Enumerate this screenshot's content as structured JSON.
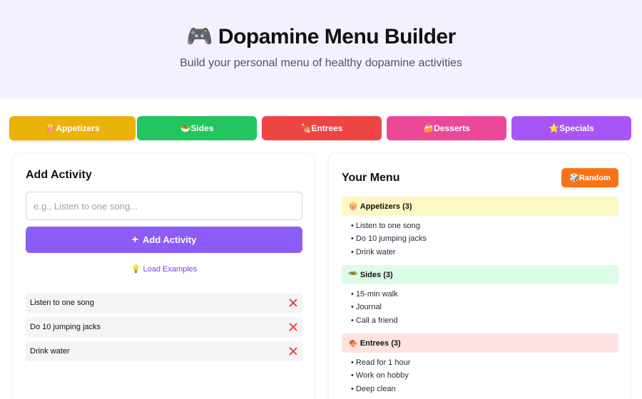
{
  "header": {
    "title_icon": "🎮",
    "title": "Dopamine Menu Builder",
    "subtitle": "Build your personal menu of healthy dopamine activities"
  },
  "tabs": [
    {
      "icon": "🍿",
      "label": "Appetizers",
      "color": "#eab308",
      "active": true
    },
    {
      "icon": "🥗",
      "label": "Sides",
      "color": "#22c55e",
      "active": false
    },
    {
      "icon": "🍖",
      "label": "Entrees",
      "color": "#ef4444",
      "active": false
    },
    {
      "icon": "🍰",
      "label": "Desserts",
      "color": "#ec4899",
      "active": false
    },
    {
      "icon": "⭐",
      "label": "Specials",
      "color": "#a855f7",
      "active": false
    }
  ],
  "add_panel": {
    "title": "Add Activity",
    "input_value": "",
    "input_placeholder": "e.g., Listen to one song...",
    "add_button_icon": "+",
    "add_button_label": "Add Activity",
    "examples_icon": "💡",
    "examples_label": "Load Examples",
    "activities": [
      "Listen to one song",
      "Do 10 jumping jacks",
      "Drink water"
    ]
  },
  "menu_panel": {
    "title": "Your Menu",
    "random_icon": "🎲",
    "random_label": "Random",
    "sections": [
      {
        "icon": "🍿",
        "name": "Appetizers",
        "count_label": "(3)",
        "bg": "#fef9c3",
        "items": [
          "Listen to one song",
          "Do 10 jumping jacks",
          "Drink water"
        ]
      },
      {
        "icon": "🥗",
        "name": "Sides",
        "count_label": "(3)",
        "bg": "#dcfce7",
        "items": [
          "15-min walk",
          "Journal",
          "Call a friend"
        ]
      },
      {
        "icon": "🍖",
        "name": "Entrees",
        "count_label": "(3)",
        "bg": "#fee2e2",
        "items": [
          "Read for 1 hour",
          "Work on hobby",
          "Deep clean"
        ]
      }
    ]
  },
  "colors": {
    "accent": "#8b5cf6",
    "random": "#f97316",
    "hero_bg": "#f5f0fd",
    "remove": "#ef4444"
  }
}
